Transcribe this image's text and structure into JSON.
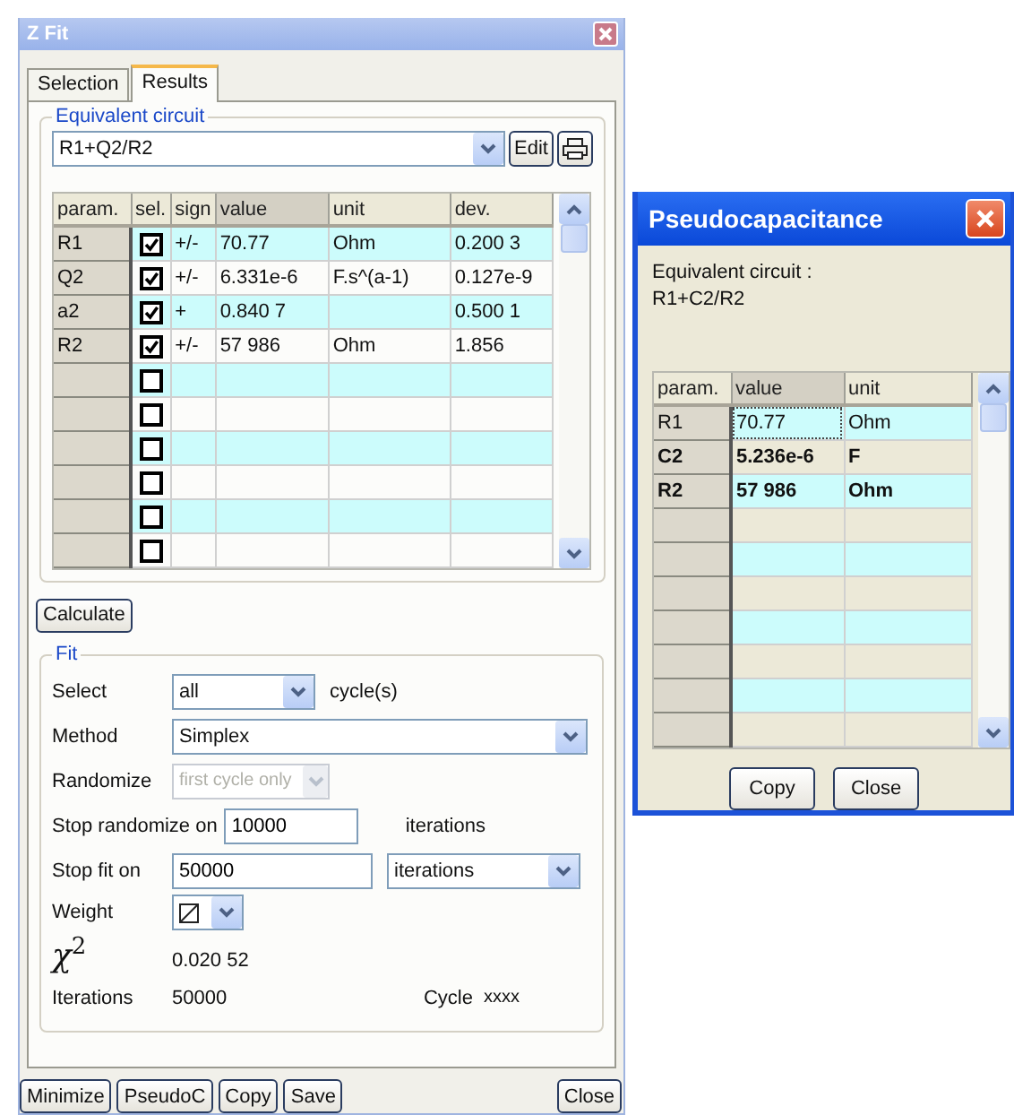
{
  "main_window": {
    "title": "Z Fit",
    "tabs": [
      {
        "label": "Selection",
        "selected": false
      },
      {
        "label": "Results",
        "selected": true
      }
    ],
    "equivalent_circuit": {
      "legend": "Equivalent circuit",
      "value": "R1+Q2/R2",
      "edit_button": "Edit"
    },
    "params_table": {
      "columns": [
        "param.",
        "sel.",
        "sign",
        "value",
        "unit",
        "dev."
      ],
      "rows": [
        {
          "param": "R1",
          "checked": true,
          "sign": "+/-",
          "value": "70.77",
          "unit": "Ohm",
          "dev": "0.200 3"
        },
        {
          "param": "Q2",
          "checked": true,
          "sign": "+/-",
          "value": "6.331e-6",
          "unit": "F.s^(a-1)",
          "dev": "0.127e-9"
        },
        {
          "param": "a2",
          "checked": true,
          "sign": "+",
          "value": "0.840 7",
          "dev": "0.500 1"
        },
        {
          "param": "R2",
          "checked": true,
          "sign": "+/-",
          "value": "57 986",
          "unit": "Ohm",
          "dev": "1.856"
        },
        {
          "checked": false
        },
        {
          "checked": false
        },
        {
          "checked": false
        },
        {
          "checked": false
        },
        {
          "checked": false
        },
        {
          "checked": false
        }
      ]
    },
    "calculate_button": "Calculate",
    "fit": {
      "legend": "Fit",
      "select": {
        "label": "Select",
        "value": "all",
        "suffix": "cycle(s)"
      },
      "method": {
        "label": "Method",
        "value": "Simplex"
      },
      "randomize": {
        "label": "Randomize",
        "value": "first cycle only",
        "disabled": true
      },
      "stop_randomize": {
        "label": "Stop randomize on",
        "value": "10000",
        "suffix": "iterations"
      },
      "stop_fit": {
        "label": "Stop fit on",
        "value": "50000",
        "unit": "iterations"
      },
      "weight": {
        "label": "Weight"
      },
      "chi2": {
        "label": "χ$^{2}$",
        "value": "0.020 52"
      },
      "iterations": {
        "label": "Iterations",
        "value": "50000"
      },
      "cycle": {
        "label": "Cycle",
        "value": "xxxx"
      }
    },
    "buttons": [
      "Minimize",
      "PseudoC",
      "Copy",
      "Save"
    ],
    "close_button": "Close"
  },
  "pseudo_window": {
    "title": "Pseudocapacitance",
    "circuit_label": "Equivalent circuit :",
    "circuit": "R1+C2/R2",
    "table": {
      "columns": [
        "param.",
        "value",
        "unit"
      ],
      "rows": [
        {
          "param": "R1",
          "value": "70.77",
          "unit": "Ohm",
          "bold": false
        },
        {
          "param": "C2",
          "value": "5.236e-6",
          "unit": "F",
          "bold": true
        },
        {
          "param": "R2",
          "value": "57 986",
          "unit": "Ohm",
          "bold": true
        },
        {},
        {},
        {},
        {},
        {},
        {},
        {}
      ]
    },
    "buttons": [
      "Copy",
      "Close"
    ]
  }
}
